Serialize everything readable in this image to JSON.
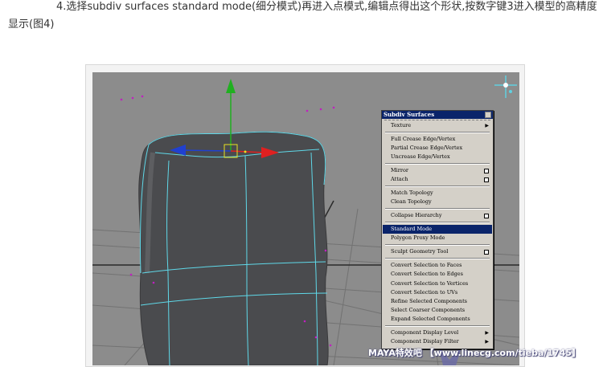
{
  "caption": {
    "text": "4.选择subdiv surfaces standard mode(细分模式)再进入点模式,编辑点得出这个形状,按数字键3进入模型的高精度显示(图4)"
  },
  "menu": {
    "title": "Subdiv Surfaces",
    "items": [
      {
        "label": "Texture",
        "type": "submenu"
      },
      {
        "label": "Full Crease Edge/Vertex",
        "type": "item"
      },
      {
        "label": "Partial Crease Edge/Vertex",
        "type": "item"
      },
      {
        "label": "Uncrease Edge/Vertex",
        "type": "item"
      },
      {
        "label": "Mirror",
        "type": "option"
      },
      {
        "label": "Attach",
        "type": "option"
      },
      {
        "label": "Match Topology",
        "type": "item"
      },
      {
        "label": "Clean Topology",
        "type": "item"
      },
      {
        "label": "Collapse Hierarchy",
        "type": "option"
      },
      {
        "label": "Standard Mode",
        "type": "item",
        "selected": true
      },
      {
        "label": "Polygon Proxy Mode",
        "type": "item"
      },
      {
        "label": "Sculpt Geometry Tool",
        "type": "option"
      },
      {
        "label": "Convert Selection to Faces",
        "type": "item"
      },
      {
        "label": "Convert Selection to Edges",
        "type": "item"
      },
      {
        "label": "Convert Selection to Vertices",
        "type": "item"
      },
      {
        "label": "Convert Selection to UVs",
        "type": "item"
      },
      {
        "label": "Refine Selected Components",
        "type": "item"
      },
      {
        "label": "Select Coarser Components",
        "type": "item"
      },
      {
        "label": "Expand Selected Components",
        "type": "item"
      },
      {
        "label": "Component Display Level",
        "type": "submenu"
      },
      {
        "label": "Component Display Filter",
        "type": "submenu"
      }
    ]
  },
  "watermark": "MAYA特效吧 【www.linecg.com/tieba/1745】",
  "colors": {
    "viewport_bg": "#8c8c8c",
    "model_fill": "#4a4b4e",
    "wire": "#5fd8e8",
    "grid": "#6e6e6e",
    "axis_x": "#e02020",
    "axis_y": "#20b020",
    "axis_z": "#2040d0",
    "menu_bg": "#d4d0c8",
    "menu_highlight": "#0a246a",
    "vertex_dots": "#c020c0"
  }
}
